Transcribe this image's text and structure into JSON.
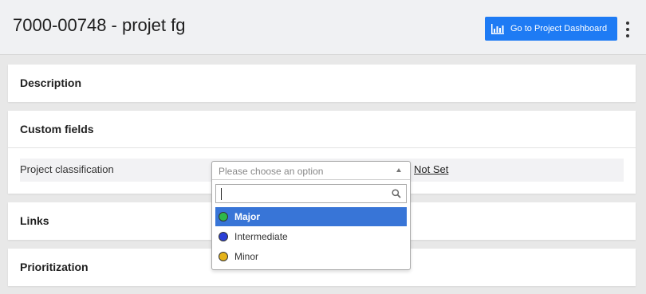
{
  "header": {
    "title": "7000-00748 - projet fg",
    "dashboard_button_label": "Go to Project Dashboard"
  },
  "sections": {
    "description": "Description",
    "custom_fields": "Custom fields",
    "links": "Links",
    "prioritization": "Prioritization"
  },
  "custom_field": {
    "label": "Project classification",
    "value": "Not Set"
  },
  "dropdown": {
    "placeholder": "Please choose an option",
    "search_value": "",
    "options": [
      {
        "label": "Major",
        "color": "#2eb84a",
        "selected": true
      },
      {
        "label": "Intermediate",
        "color": "#2a3fd6",
        "selected": false
      },
      {
        "label": "Minor",
        "color": "#e5b31a",
        "selected": false
      }
    ]
  },
  "colors": {
    "accent": "#1e7bf4",
    "selected_option": "#3875d7"
  }
}
